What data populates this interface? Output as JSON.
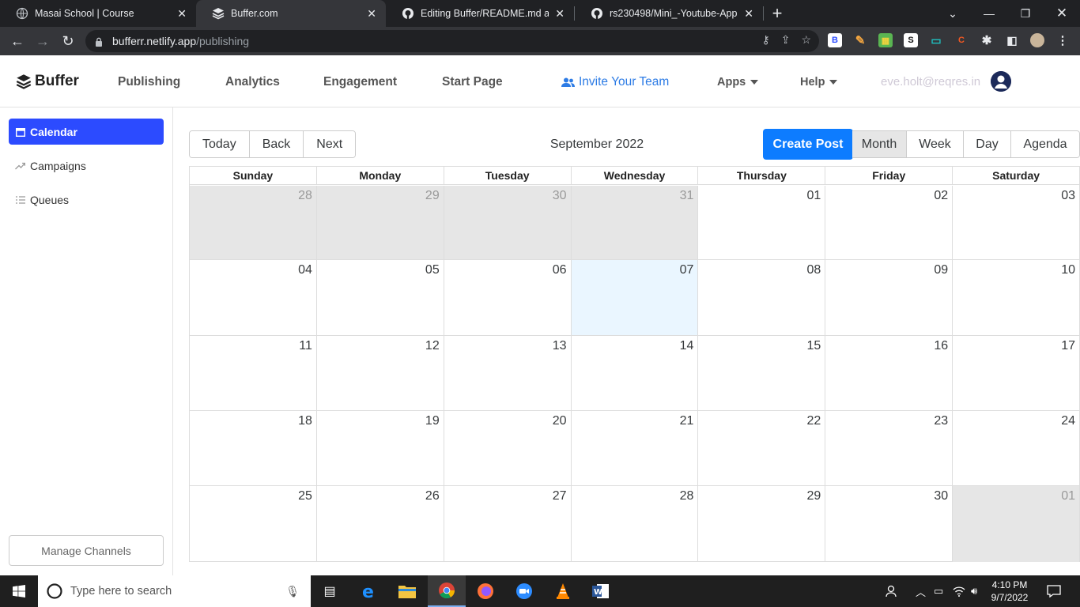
{
  "browser": {
    "tabs": [
      {
        "title": "Masai School | Course",
        "active": false
      },
      {
        "title": "Buffer.com",
        "active": true
      },
      {
        "title": "Editing Buffer/README.md at ma",
        "active": false
      },
      {
        "title": "rs230498/Mini_-Youtube-App: M",
        "active": false
      }
    ],
    "url_host": "bufferr.netlify.app",
    "url_path": "/publishing"
  },
  "app": {
    "logo": "Buffer",
    "nav": [
      "Publishing",
      "Analytics",
      "Engagement",
      "Start Page"
    ],
    "invite": "Invite Your Team",
    "apps": "Apps",
    "help": "Help",
    "email": "eve.holt@reqres.in"
  },
  "sidebar": {
    "items": [
      {
        "label": "Calendar",
        "icon": "calendar-icon",
        "active": true
      },
      {
        "label": "Campaigns",
        "icon": "trend-icon",
        "active": false
      },
      {
        "label": "Queues",
        "icon": "list-icon",
        "active": false
      }
    ],
    "manage": "Manage Channels"
  },
  "calendar": {
    "nav_buttons": [
      "Today",
      "Back",
      "Next"
    ],
    "title": "September 2022",
    "create": "Create Post",
    "views": [
      "Month",
      "Week",
      "Day",
      "Agenda"
    ],
    "active_view": "Month",
    "days_of_week": [
      "Sunday",
      "Monday",
      "Tuesday",
      "Wednesday",
      "Thursday",
      "Friday",
      "Saturday"
    ],
    "weeks": [
      [
        "28",
        "29",
        "30",
        "31",
        "01",
        "02",
        "03"
      ],
      [
        "04",
        "05",
        "06",
        "07",
        "08",
        "09",
        "10"
      ],
      [
        "11",
        "12",
        "13",
        "14",
        "15",
        "16",
        "17"
      ],
      [
        "18",
        "19",
        "20",
        "21",
        "22",
        "23",
        "24"
      ],
      [
        "25",
        "26",
        "27",
        "28",
        "29",
        "30",
        "01"
      ]
    ],
    "off_range": [
      [
        0,
        0
      ],
      [
        0,
        1
      ],
      [
        0,
        2
      ],
      [
        0,
        3
      ],
      [
        4,
        6
      ]
    ],
    "today": [
      1,
      3
    ]
  },
  "taskbar": {
    "search_placeholder": "Type here to search",
    "time": "4:10 PM",
    "date": "9/7/2022"
  }
}
